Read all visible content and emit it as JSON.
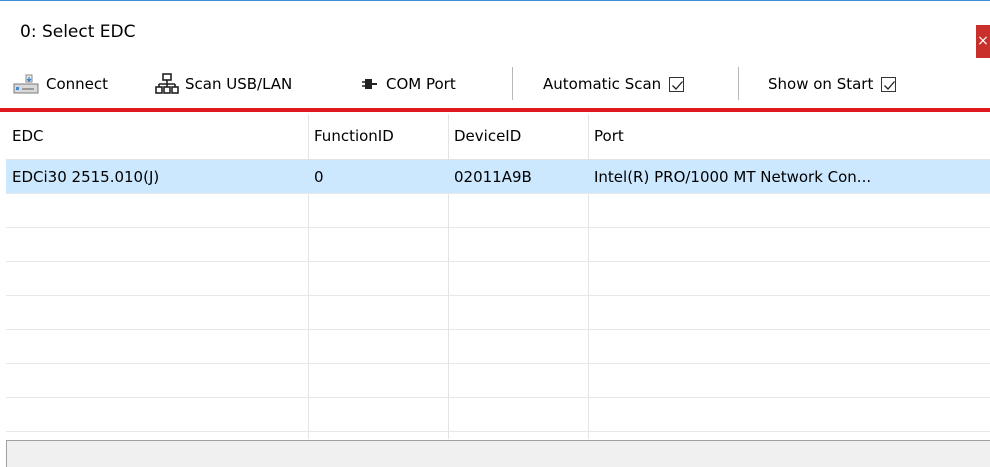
{
  "window": {
    "title": "0: Select EDC",
    "close_glyph": "×"
  },
  "toolbar": {
    "connect": {
      "label": "Connect",
      "icon": "connect-icon"
    },
    "scan": {
      "label": "Scan USB/LAN",
      "icon": "network-icon"
    },
    "com": {
      "label": "COM Port",
      "icon": "plug-icon"
    },
    "auto_scan": {
      "label": "Automatic Scan",
      "checked": true
    },
    "show_on_start": {
      "label": "Show on Start",
      "checked": true
    }
  },
  "grid": {
    "columns": [
      "EDC",
      "FunctionID",
      "DeviceID",
      "Port"
    ],
    "rows": [
      {
        "edc": "EDCi30  2515.010(J)",
        "function_id": "0",
        "device_id": "02011A9B",
        "port": "Intel(R) PRO/1000 MT Network Con...",
        "selected": true
      }
    ]
  },
  "colors": {
    "accent_red": "#e0191e",
    "selection": "#cce8ff",
    "close_button": "#c9302c"
  }
}
